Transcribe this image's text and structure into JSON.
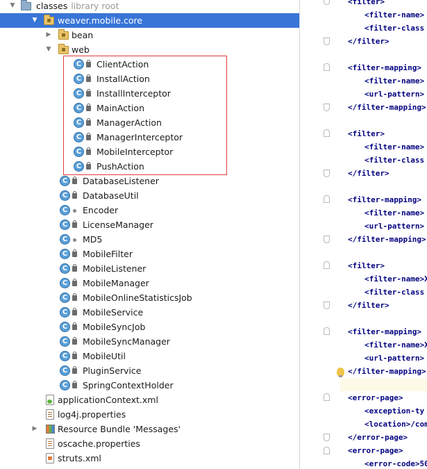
{
  "tree": {
    "rows": [
      {
        "label": "classes",
        "hint": "library root"
      },
      {
        "label": "weaver.mobile.core"
      },
      {
        "label": "bean"
      },
      {
        "label": "web"
      },
      {
        "label": "ClientAction"
      },
      {
        "label": "InstallAction"
      },
      {
        "label": "InstallInterceptor"
      },
      {
        "label": "MainAction"
      },
      {
        "label": "ManagerAction"
      },
      {
        "label": "ManagerInterceptor"
      },
      {
        "label": "MobileInterceptor"
      },
      {
        "label": "PushAction"
      },
      {
        "label": "DatabaseListener"
      },
      {
        "label": "DatabaseUtil"
      },
      {
        "label": "Encoder"
      },
      {
        "label": "LicenseManager"
      },
      {
        "label": "MD5"
      },
      {
        "label": "MobileFilter"
      },
      {
        "label": "MobileListener"
      },
      {
        "label": "MobileManager"
      },
      {
        "label": "MobileOnlineStatisticsJob"
      },
      {
        "label": "MobileService"
      },
      {
        "label": "MobileSyncJob"
      },
      {
        "label": "MobileSyncManager"
      },
      {
        "label": "MobileUtil"
      },
      {
        "label": "PluginService"
      },
      {
        "label": "SpringContextHolder"
      },
      {
        "label": "applicationContext.xml"
      },
      {
        "label": "log4j.properties"
      },
      {
        "label": "Resource Bundle 'Messages'"
      },
      {
        "label": "oscache.properties"
      },
      {
        "label": "struts.xml"
      }
    ],
    "selected": "weaver.mobile.core",
    "class_icon_letter": "C",
    "colors": {
      "selection": "#3875d7",
      "highlight_box": "#e23b3b"
    }
  },
  "editor": {
    "lines": [
      "<filter>",
      "<filter-name>",
      "<filter-class",
      "</filter>",
      "",
      "<filter-mapping>",
      "<filter-name>",
      "<url-pattern>",
      "</filter-mapping>",
      "",
      "<filter>",
      "<filter-name>",
      "<filter-class",
      "</filter>",
      "",
      "<filter-mapping>",
      "<filter-name>",
      "<url-pattern>",
      "</filter-mapping>",
      "",
      "<filter>",
      "<filter-name>X",
      "<filter-class",
      "</filter>",
      "",
      "<filter-mapping>",
      "<filter-name>X",
      "<url-pattern>",
      "</filter-mapping>",
      "",
      "<error-page>",
      "<exception-ty",
      "<location>/com",
      "</error-page>",
      "<error-page>",
      "<error-code>50"
    ]
  }
}
